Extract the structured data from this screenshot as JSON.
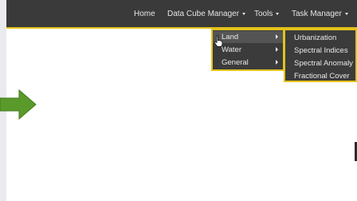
{
  "navbar": {
    "items": [
      {
        "label": "Home"
      },
      {
        "label": "Data Cube Manager"
      },
      {
        "label": "Tools"
      },
      {
        "label": "Task Manager"
      }
    ]
  },
  "tools_menu": {
    "items": [
      {
        "label": "Land"
      },
      {
        "label": "Water"
      },
      {
        "label": "General"
      }
    ]
  },
  "land_submenu": {
    "items": [
      {
        "label": "Urbanization"
      },
      {
        "label": "Spectral Indices"
      },
      {
        "label": "Spectral Anomaly"
      },
      {
        "label": "Fractional Cover"
      }
    ]
  },
  "colors": {
    "navbar_bg": "#3a3a3a",
    "highlight_border": "#e3c21b",
    "arrow_green": "#5a9a2a"
  },
  "icons": [
    "hand-cursor-icon",
    "right-arrow-icon",
    "caret-down-icon",
    "submenu-arrow-icon"
  ]
}
